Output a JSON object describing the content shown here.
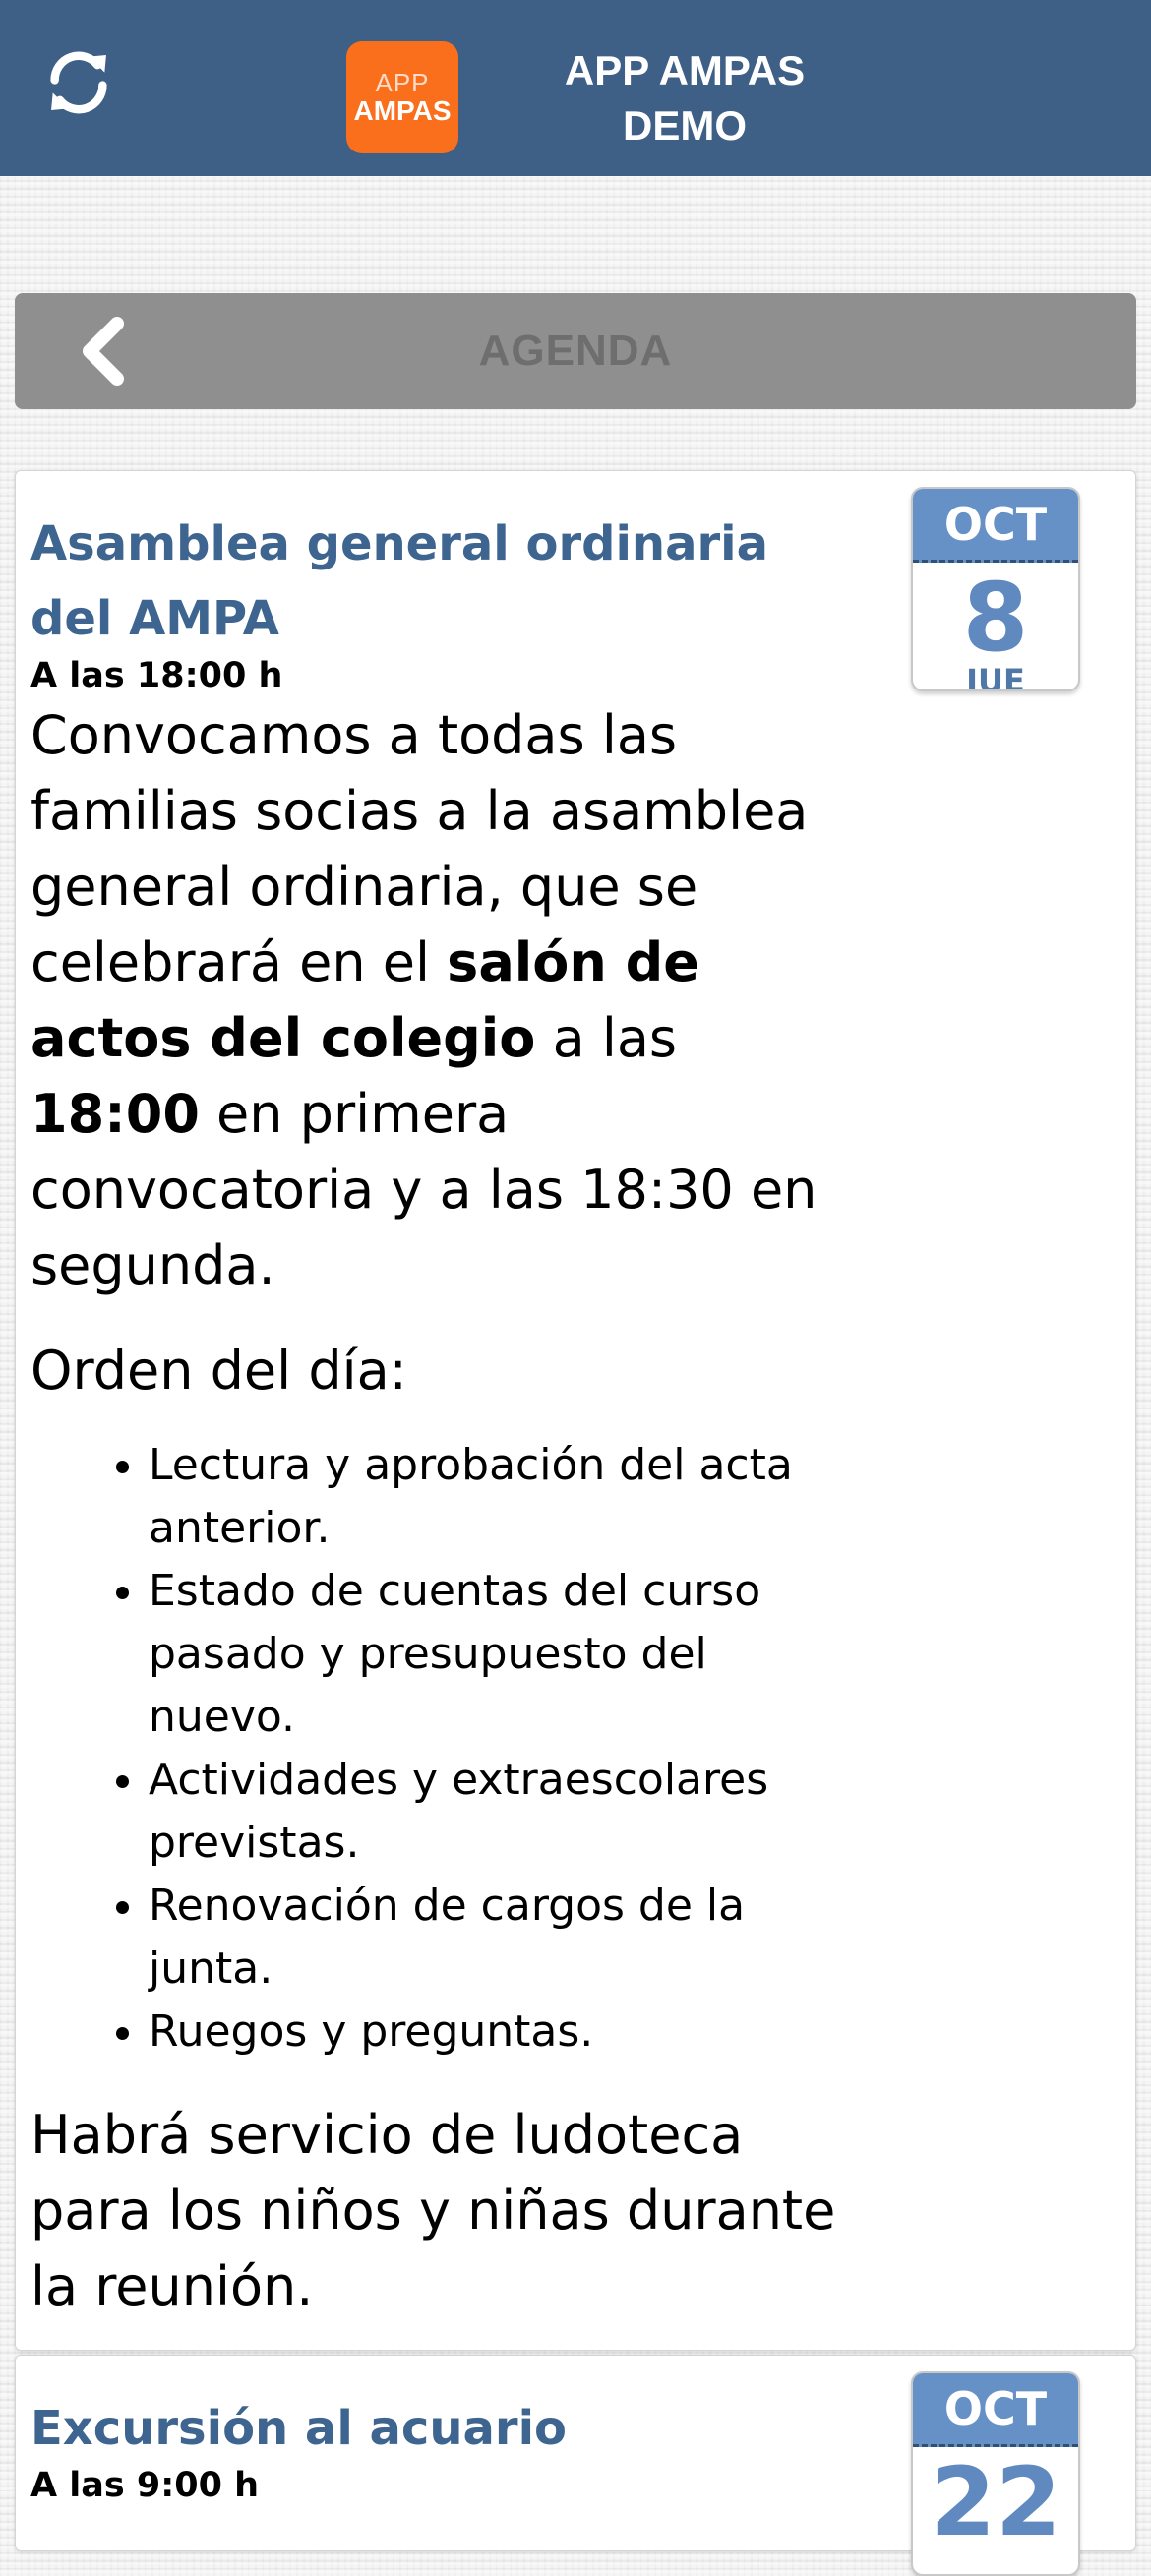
{
  "app": {
    "logo_line1": "APP",
    "logo_line2": "AMPAS",
    "title": "APP AMPAS DEMO"
  },
  "icons": {
    "refresh": "refresh-icon",
    "back": "chevron-left-icon"
  },
  "colors": {
    "header_bg": "#3e5f86",
    "logo_bg": "#f96f1c",
    "section_bar_bg": "#8f8f8f",
    "event_title": "#3e6490",
    "badge_month_bg": "#6591c6",
    "badge_day": "#5f89bf"
  },
  "section": {
    "title": "AGENDA"
  },
  "events": [
    {
      "title": "Asamblea general ordinaria del AMPA",
      "time": "A las 18:00 h",
      "desc_parts": [
        "Convocamos a todas las familias socias a la asamblea general ordinaria, que se celebrará en el ",
        "salón de actos del colegio",
        " a las ",
        "18:00",
        " en primera convocatoria y a las 18:30 en segunda."
      ],
      "agenda_heading": "Orden del día:",
      "agenda_items": [
        "Lectura y aprobación del acta anterior.",
        "Estado de cuentas del curso pasado y presupuesto del nuevo.",
        "Actividades y extraescolares previstas.",
        "Renovación de cargos de la junta.",
        "Ruegos y preguntas."
      ],
      "footer": "Habrá servicio de ludoteca para los niños y niñas durante la reunión.",
      "date": {
        "month": "OCT",
        "day": "8",
        "weekday": "JUE"
      }
    },
    {
      "title": "Excursión al acuario",
      "time": "A las 9:00 h",
      "date": {
        "month": "OCT",
        "day": "22"
      }
    }
  ]
}
